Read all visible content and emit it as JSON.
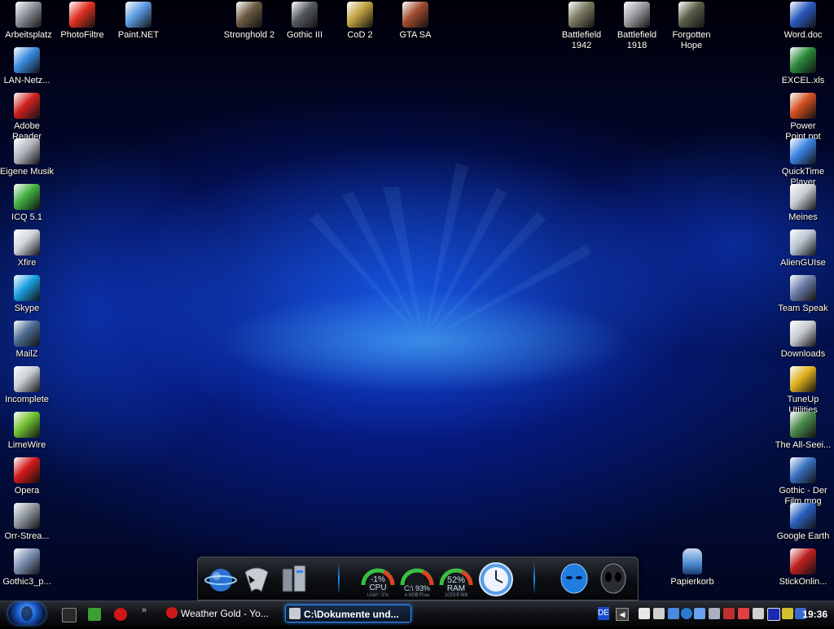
{
  "desktop": {
    "top_row": [
      {
        "label": "Arbeitsplatz",
        "icon": "computer-icon",
        "color": "#8a8f98"
      },
      {
        "label": "PhotoFiltre",
        "icon": "photofiltre-icon",
        "color": "#e03020"
      },
      {
        "label": "Paint.NET",
        "icon": "paint-net-icon",
        "color": "#5a9ae0"
      },
      {
        "label": "Stronghold 2",
        "icon": "stronghold-icon",
        "color": "#6b5a40"
      },
      {
        "label": "Gothic III",
        "icon": "gothic-icon",
        "color": "#555a60"
      },
      {
        "label": "CoD 2",
        "icon": "cod-icon",
        "color": "#c0a040"
      },
      {
        "label": "GTA SA",
        "icon": "gta-icon",
        "color": "#a04a30"
      },
      {
        "label": "Battlefield 1942",
        "icon": "battlefield-icon",
        "color": "#7a7a60"
      },
      {
        "label": "Battlefield 1918",
        "icon": "battlefield-icon",
        "color": "#9a9aa0"
      },
      {
        "label": "Forgotten Hope",
        "icon": "soldier-icon",
        "color": "#5a6048"
      },
      {
        "label": "Word.doc",
        "icon": "word-doc-icon",
        "color": "#2a5cc0"
      }
    ],
    "left_column": [
      {
        "label": "LAN-Netz...",
        "icon": "network-icon",
        "color": "#3a8ae0"
      },
      {
        "label": "Adobe Reader",
        "icon": "pdf-icon",
        "color": "#d02020"
      },
      {
        "label": "Eigene Musik",
        "icon": "music-folder-icon",
        "color": "#b0b4bc"
      },
      {
        "label": "ICQ 5.1",
        "icon": "icq-icon",
        "color": "#40b040"
      },
      {
        "label": "Xfire",
        "icon": "xfire-icon",
        "color": "#d0d4da"
      },
      {
        "label": "Skype",
        "icon": "skype-icon",
        "color": "#1aa0e0"
      },
      {
        "label": "MailZ",
        "icon": "mail-icon",
        "color": "#4a6a90"
      },
      {
        "label": "Incomplete",
        "icon": "folder-icon",
        "color": "#c8ccd2"
      },
      {
        "label": "LimeWire",
        "icon": "limewire-icon",
        "color": "#70c030"
      },
      {
        "label": "Opera",
        "icon": "opera-icon",
        "color": "#d01818"
      },
      {
        "label": "Orr-Strea...",
        "icon": "stream-icon",
        "color": "#9098a0"
      },
      {
        "label": "Gothic3_p...",
        "icon": "shortcut-icon",
        "color": "#7a90b0"
      }
    ],
    "right_column": [
      {
        "label": "EXCEL.xls",
        "icon": "excel-icon",
        "color": "#2a8a3a"
      },
      {
        "label": "Power Point.ppt",
        "icon": "powerpoint-icon",
        "color": "#d05020"
      },
      {
        "label": "QuickTime Player",
        "icon": "quicktime-icon",
        "color": "#3a80e0"
      },
      {
        "label": "Meines",
        "icon": "folder-icon",
        "color": "#c8ccd2"
      },
      {
        "label": "AlienGUIse",
        "icon": "alien-icon",
        "color": "#b8c4d0"
      },
      {
        "label": "Team Speak",
        "icon": "teamspeak-icon",
        "color": "#6a7aa8"
      },
      {
        "label": "Downloads",
        "icon": "folder-icon",
        "color": "#c8ccd2"
      },
      {
        "label": "TuneUp Utilities",
        "icon": "tuneup-icon",
        "color": "#e0b020"
      },
      {
        "label": "The All-Seei...",
        "icon": "eye-pyramid-icon",
        "color": "#4a8a4a"
      },
      {
        "label": "Gothic - Der Film.mpg",
        "icon": "media-file-icon",
        "color": "#3a70c0"
      },
      {
        "label": "Google Earth",
        "icon": "globe-icon",
        "color": "#2a60c0"
      },
      {
        "label": "StickOnlin...",
        "icon": "stickonline-icon",
        "color": "#c02020"
      }
    ],
    "recycle_bin": {
      "label": "Papierkorb",
      "icon": "recycle-bin-icon",
      "color": "#4a8ad0"
    }
  },
  "dock": {
    "items": [
      {
        "name": "internet-globe-icon",
        "color": "#3a8ae0"
      },
      {
        "name": "alien-head-icon",
        "color": "#b0b6c0"
      },
      {
        "name": "computer-tower-icon",
        "color": "#9aa2ae"
      }
    ],
    "gauges": {
      "cpu": {
        "percent": "-1%",
        "label": "CPU",
        "sub": "User: -1%"
      },
      "drive": {
        "percent": "C:\\ 93%",
        "sub": "4.6GB Free"
      },
      "ram": {
        "percent": "52%",
        "label": "RAM",
        "sub": "1023.5 MB"
      }
    },
    "right_items": [
      {
        "name": "alien-logo-icon",
        "color": "#1f7de0"
      },
      {
        "name": "alien-mask-icon",
        "color": "#2a2c30"
      }
    ]
  },
  "taskbar": {
    "tasks": [
      {
        "label": "Weather Gold - Yo...",
        "icon": "opera-icon"
      },
      {
        "label": "C:\\Dokumente und...",
        "icon": "folder-icon"
      }
    ],
    "language": "DE",
    "clock": "19:36"
  }
}
